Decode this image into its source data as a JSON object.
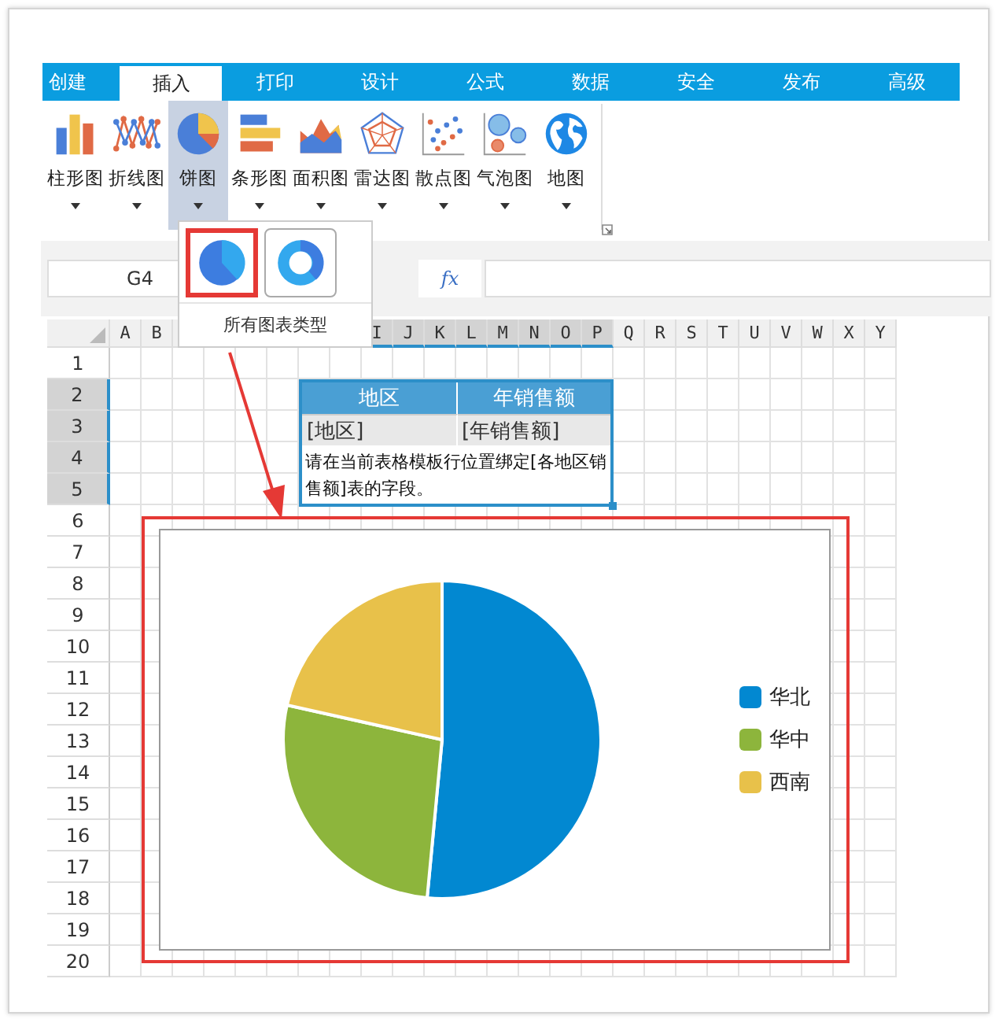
{
  "ribbon": {
    "tabs": [
      {
        "label": "创建",
        "selected": false
      },
      {
        "label": "插入",
        "selected": true
      },
      {
        "label": "打印",
        "selected": false
      },
      {
        "label": "设计",
        "selected": false
      },
      {
        "label": "公式",
        "selected": false
      },
      {
        "label": "数据",
        "selected": false
      },
      {
        "label": "安全",
        "selected": false
      },
      {
        "label": "发布",
        "selected": false
      },
      {
        "label": "高级",
        "selected": false
      }
    ],
    "chart_buttons": [
      {
        "label": "柱形图",
        "kind": "column",
        "selected": false
      },
      {
        "label": "折线图",
        "kind": "line",
        "selected": false
      },
      {
        "label": "饼图",
        "kind": "pie",
        "selected": true
      },
      {
        "label": "条形图",
        "kind": "bar",
        "selected": false
      },
      {
        "label": "面积图",
        "kind": "area",
        "selected": false
      },
      {
        "label": "雷达图",
        "kind": "radar",
        "selected": false
      },
      {
        "label": "散点图",
        "kind": "scatter",
        "selected": false
      },
      {
        "label": "气泡图",
        "kind": "bubble",
        "selected": false
      },
      {
        "label": "地图",
        "kind": "map",
        "selected": false
      }
    ]
  },
  "chart_type_menu": {
    "options": [
      {
        "kind": "pie",
        "selected": true
      },
      {
        "kind": "donut",
        "selected": false
      }
    ],
    "footer": "所有图表类型"
  },
  "formula_bar": {
    "cell_reference": "G4",
    "function_label": "fx"
  },
  "sheet": {
    "columns": [
      {
        "label": "A",
        "selected": false
      },
      {
        "label": "B",
        "selected": false
      },
      {
        "selected": false
      },
      null,
      null,
      null,
      null,
      null,
      {
        "label": "I",
        "selected": true
      },
      {
        "label": "J",
        "selected": true
      },
      {
        "label": "K",
        "selected": true
      },
      {
        "label": "L",
        "selected": true
      },
      {
        "label": "M",
        "selected": true
      },
      {
        "label": "N",
        "selected": true
      },
      {
        "label": "O",
        "selected": true
      },
      {
        "label": "P",
        "selected": true
      },
      {
        "label": "Q",
        "selected": false
      },
      {
        "label": "R",
        "selected": false
      },
      {
        "label": "S",
        "selected": false
      },
      {
        "label": "T",
        "selected": false
      },
      {
        "label": "U",
        "selected": false
      },
      {
        "label": "V",
        "selected": false
      },
      {
        "label": "W",
        "selected": false
      },
      {
        "label": "X",
        "selected": false
      },
      {
        "label": "Y",
        "selected": false
      }
    ],
    "rows": [
      {
        "label": "1",
        "selected": false
      },
      {
        "label": "2",
        "selected": true
      },
      {
        "label": "3",
        "selected": true
      },
      {
        "label": "4",
        "selected": true
      },
      {
        "label": "5",
        "selected": true
      },
      {
        "label": "6",
        "selected": false
      },
      {
        "label": "7",
        "selected": false
      },
      {
        "label": "8",
        "selected": false
      },
      {
        "label": "9",
        "selected": false
      },
      {
        "label": "10",
        "selected": false
      },
      {
        "label": "11",
        "selected": false
      },
      {
        "label": "12",
        "selected": false
      },
      {
        "label": "13",
        "selected": false
      },
      {
        "label": "14",
        "selected": false
      },
      {
        "label": "15",
        "selected": false
      },
      {
        "label": "16",
        "selected": false
      },
      {
        "label": "17",
        "selected": false
      },
      {
        "label": "18",
        "selected": false
      },
      {
        "label": "19",
        "selected": false
      },
      {
        "label": "20",
        "selected": false
      }
    ]
  },
  "template_table": {
    "headers": [
      "地区",
      "年销售额"
    ],
    "fields": [
      "[地区]",
      "[年销售额]"
    ],
    "note": "请在当前表格模板行位置绑定[各地区销售额]表的字段。"
  },
  "chart": {
    "legend": [
      {
        "label": "华北",
        "color": "#0288d1"
      },
      {
        "label": "华中",
        "color": "#8db53c"
      },
      {
        "label": "西南",
        "color": "#e8c14a"
      }
    ]
  }
}
